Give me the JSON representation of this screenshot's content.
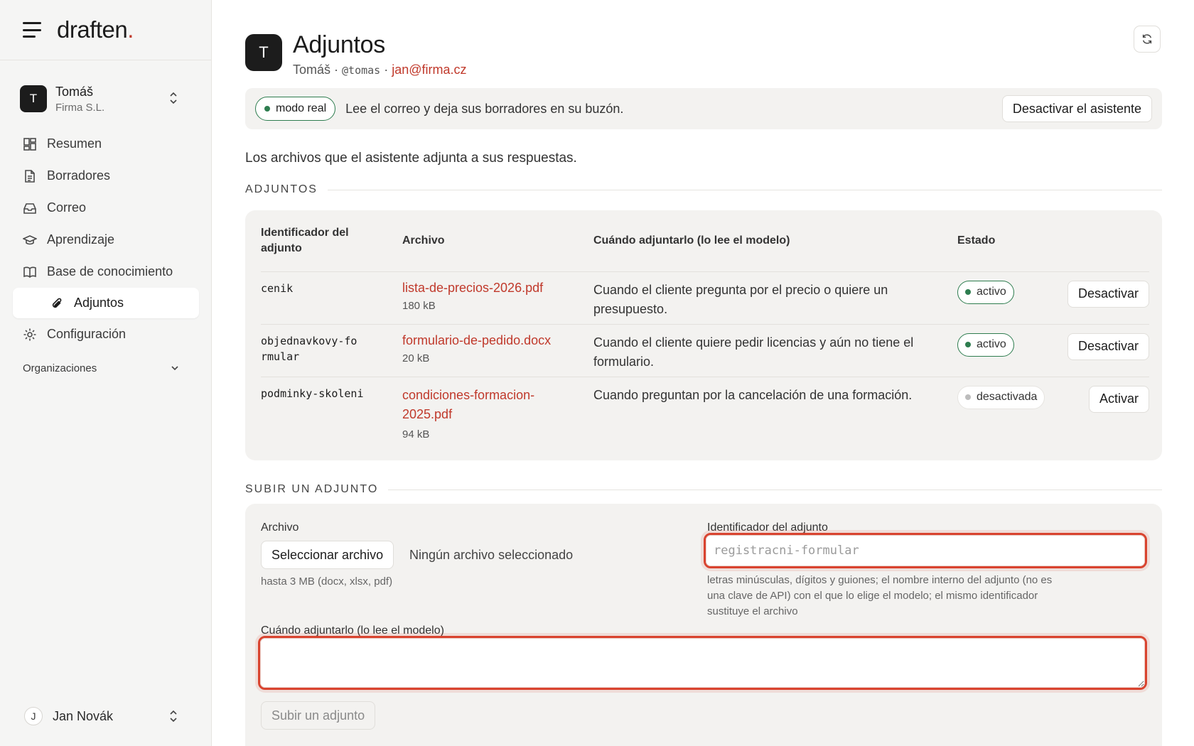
{
  "brand": {
    "name": "draften",
    "dot": "."
  },
  "org": {
    "initial": "T",
    "name": "Tomáš",
    "company": "Firma S.L."
  },
  "nav": {
    "items": [
      {
        "label": "Resumen",
        "icon": "dashboard-icon"
      },
      {
        "label": "Borradores",
        "icon": "document-icon"
      },
      {
        "label": "Correo",
        "icon": "inbox-icon"
      },
      {
        "label": "Aprendizaje",
        "icon": "graduation-cap-icon"
      },
      {
        "label": "Base de conocimiento",
        "icon": "book-icon"
      }
    ],
    "sub_item": {
      "label": "Adjuntos",
      "icon": "paperclip-icon"
    },
    "settings": {
      "label": "Configuración",
      "icon": "gear-icon"
    },
    "group": {
      "label": "Organizaciones"
    }
  },
  "user": {
    "initial": "J",
    "name": "Jan Novák"
  },
  "header": {
    "initial": "T",
    "title": "Adjuntos",
    "name": "Tomáš",
    "sep1": " · ",
    "handle": "@tomas",
    "sep2": " · ",
    "email": "jan@firma.cz"
  },
  "banner": {
    "mode": "modo real",
    "text": "Lee el correo y deja sus borradores en su buzón.",
    "button": "Desactivar el asistente"
  },
  "intro": "Los archivos que el asistente adjunta a sus respuestas.",
  "attachments": {
    "section_title": "ADJUNTOS",
    "columns": [
      "Identificador del adjunto",
      "Archivo",
      "Cuándo adjuntarlo (lo lee el modelo)",
      "Estado"
    ],
    "rows": [
      {
        "id": "cenik",
        "file": "lista-de-precios-2026.pdf",
        "size": "180 kB",
        "when": "Cuando el cliente pregunta por el precio o quiere un presupuesto.",
        "status": "activo",
        "active": true,
        "action": "Desactivar"
      },
      {
        "id": "objednavkovy-formular",
        "file": "formulario-de-pedido.docx",
        "size": "20 kB",
        "when": "Cuando el cliente quiere pedir licencias y aún no tiene el formulario.",
        "status": "activo",
        "active": true,
        "action": "Desactivar"
      },
      {
        "id": "podminky-skoleni",
        "file": "condiciones-formacion-2025.pdf",
        "size": "94 kB",
        "when": "Cuando preguntan por la cancelación de una formación.",
        "status": "desactivada",
        "active": false,
        "action": "Activar"
      }
    ]
  },
  "upload": {
    "section_title": "SUBIR UN ADJUNTO",
    "file_label": "Archivo",
    "choose_button": "Seleccionar archivo",
    "no_file": "Ningún archivo seleccionado",
    "file_help": "hasta 3 MB (docx, xlsx, pdf)",
    "id_label": "Identificador del adjunto",
    "id_value": "",
    "id_placeholder": "registracni-formular",
    "id_help": "letras minúsculas, dígitos y guiones; el nombre interno del adjunto (no es una clave de API) con el que lo elige el modelo; el mismo identificador sustituye el archivo",
    "when_label": "Cuándo adjuntarlo (lo lee el modelo)",
    "when_value": "",
    "submit": "Subir un adjunto"
  },
  "colors": {
    "accent": "#c0392b",
    "active": "#2e7d4f",
    "focus_ring": "#d9432f",
    "sidebar_bg": "#f5f5f4"
  }
}
